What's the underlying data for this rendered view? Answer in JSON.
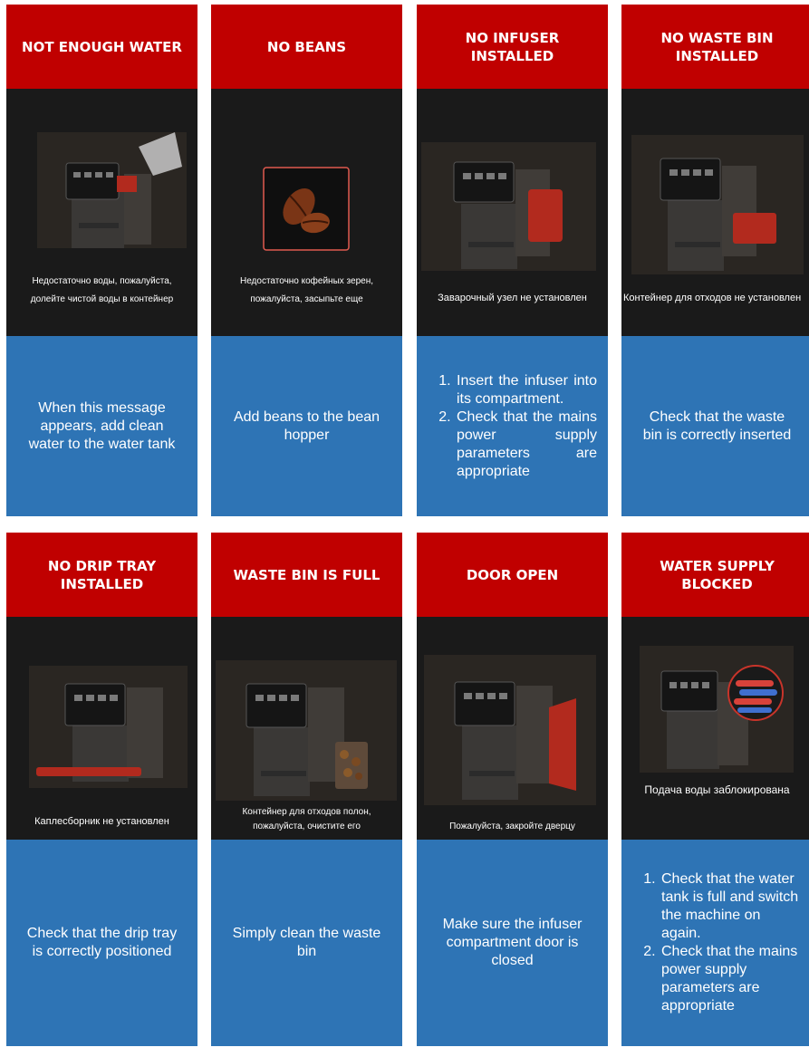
{
  "panels": [
    {
      "title": "NOT ENOUGH WATER",
      "caption_lines": [
        "Недостаточно воды, пожалуйста,",
        "долейте чистой воды в контейнер"
      ],
      "help": "When this message appears, add clean water to the water tank",
      "image_icon": "coffee-machine-water-jug-icon"
    },
    {
      "title": "NO BEANS",
      "caption_lines": [
        "Недостаточно кофейных зерен,",
        "пожалуйста, засыпьте еще"
      ],
      "help": "Add beans to the bean hopper",
      "image_icon": "coffee-beans-icon"
    },
    {
      "title": "NO INFUSER INSTALLED",
      "caption_lines": [
        "Заварочный узел не установлен"
      ],
      "help_list": [
        "Insert the infuser into its compartment.",
        "Check that the mains power supply parameters are appropriate"
      ],
      "image_icon": "coffee-machine-infuser-icon"
    },
    {
      "title": "NO WASTE BIN INSTALLED",
      "caption_lines": [
        "Контейнер для отходов не установлен"
      ],
      "help": "Check that the waste bin is correctly inserted",
      "image_icon": "coffee-machine-waste-bin-icon"
    },
    {
      "title": "NO DRIP TRAY INSTALLED",
      "caption_lines": [
        "Каплесборник не установлен"
      ],
      "help": "Check that the drip tray is correctly positioned",
      "image_icon": "coffee-machine-drip-tray-icon"
    },
    {
      "title": "WASTE BIN IS FULL",
      "caption_lines": [
        "Контейнер для отходов полон,",
        "пожалуйста, очистите его"
      ],
      "help": "Simply clean the waste bin",
      "image_icon": "coffee-machine-full-bin-icon"
    },
    {
      "title": "DOOR OPEN",
      "caption_lines": [
        "Пожалуйста, закройте дверцу"
      ],
      "help": "Make sure the infuser compartment door is closed",
      "image_icon": "coffee-machine-door-open-icon"
    },
    {
      "title": "WATER SUPPLY BLOCKED",
      "caption_lines": [
        "Подача воды заблокирована"
      ],
      "help_list": [
        "Check that the water tank is full and switch the machine on again.",
        "Check that the mains power supply parameters are appropriate"
      ],
      "image_icon": "water-supply-blocked-icon"
    }
  ],
  "colors": {
    "header_red": "#c00000",
    "screen_dark": "#1a1a1a",
    "help_blue": "#2e74b5",
    "part_red": "#b22a1e"
  }
}
